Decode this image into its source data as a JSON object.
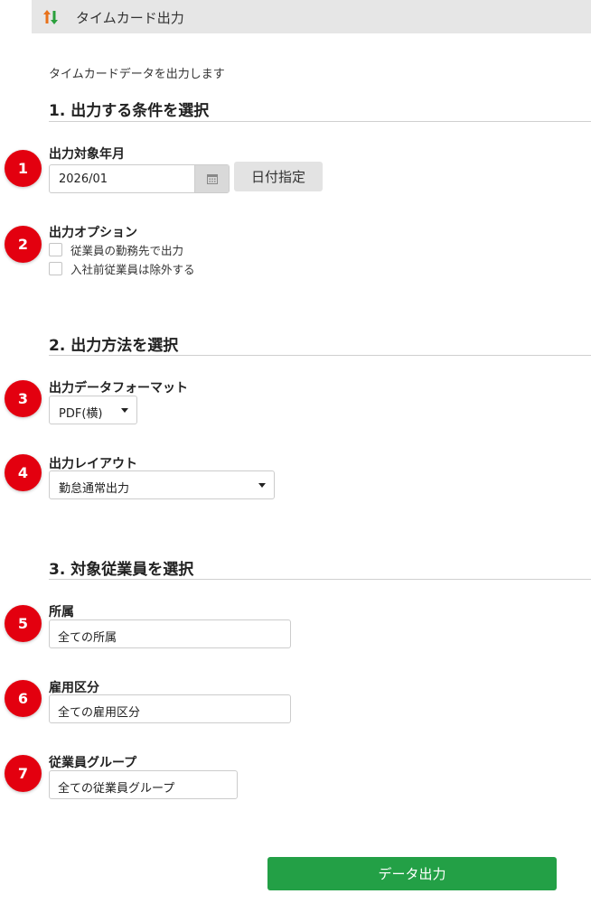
{
  "header": {
    "title": "タイムカード出力",
    "icon": "sort-arrows-icon",
    "icon_colors": {
      "up": "#e8711a",
      "down": "#2aa03c"
    }
  },
  "intro": "タイムカードデータを出力します",
  "sections": [
    {
      "title": "1. 出力する条件を選択"
    },
    {
      "title": "2. 出力方法を選択"
    },
    {
      "title": "3. 対象従業員を選択"
    }
  ],
  "badges": [
    "1",
    "2",
    "3",
    "4",
    "5",
    "6",
    "7"
  ],
  "badge_color": "#e3000f",
  "fields": {
    "target_month": {
      "label": "出力対象年月",
      "value": "2026/01",
      "date_button": "日付指定"
    },
    "options": {
      "label": "出力オプション",
      "items": [
        {
          "label": "従業員の勤務先で出力",
          "checked": false
        },
        {
          "label": "入社前従業員は除外する",
          "checked": false
        }
      ]
    },
    "format": {
      "label": "出力データフォーマット",
      "value": "PDF(横)"
    },
    "layout": {
      "label": "出力レイアウト",
      "value": "勤怠通常出力"
    },
    "department": {
      "label": "所属",
      "value": "全ての所属"
    },
    "employment_type": {
      "label": "雇用区分",
      "value": "全ての雇用区分"
    },
    "employee_group": {
      "label": "従業員グループ",
      "value": "全ての従業員グループ"
    }
  },
  "submit_label": "データ出力",
  "accent_color": "#23a046"
}
